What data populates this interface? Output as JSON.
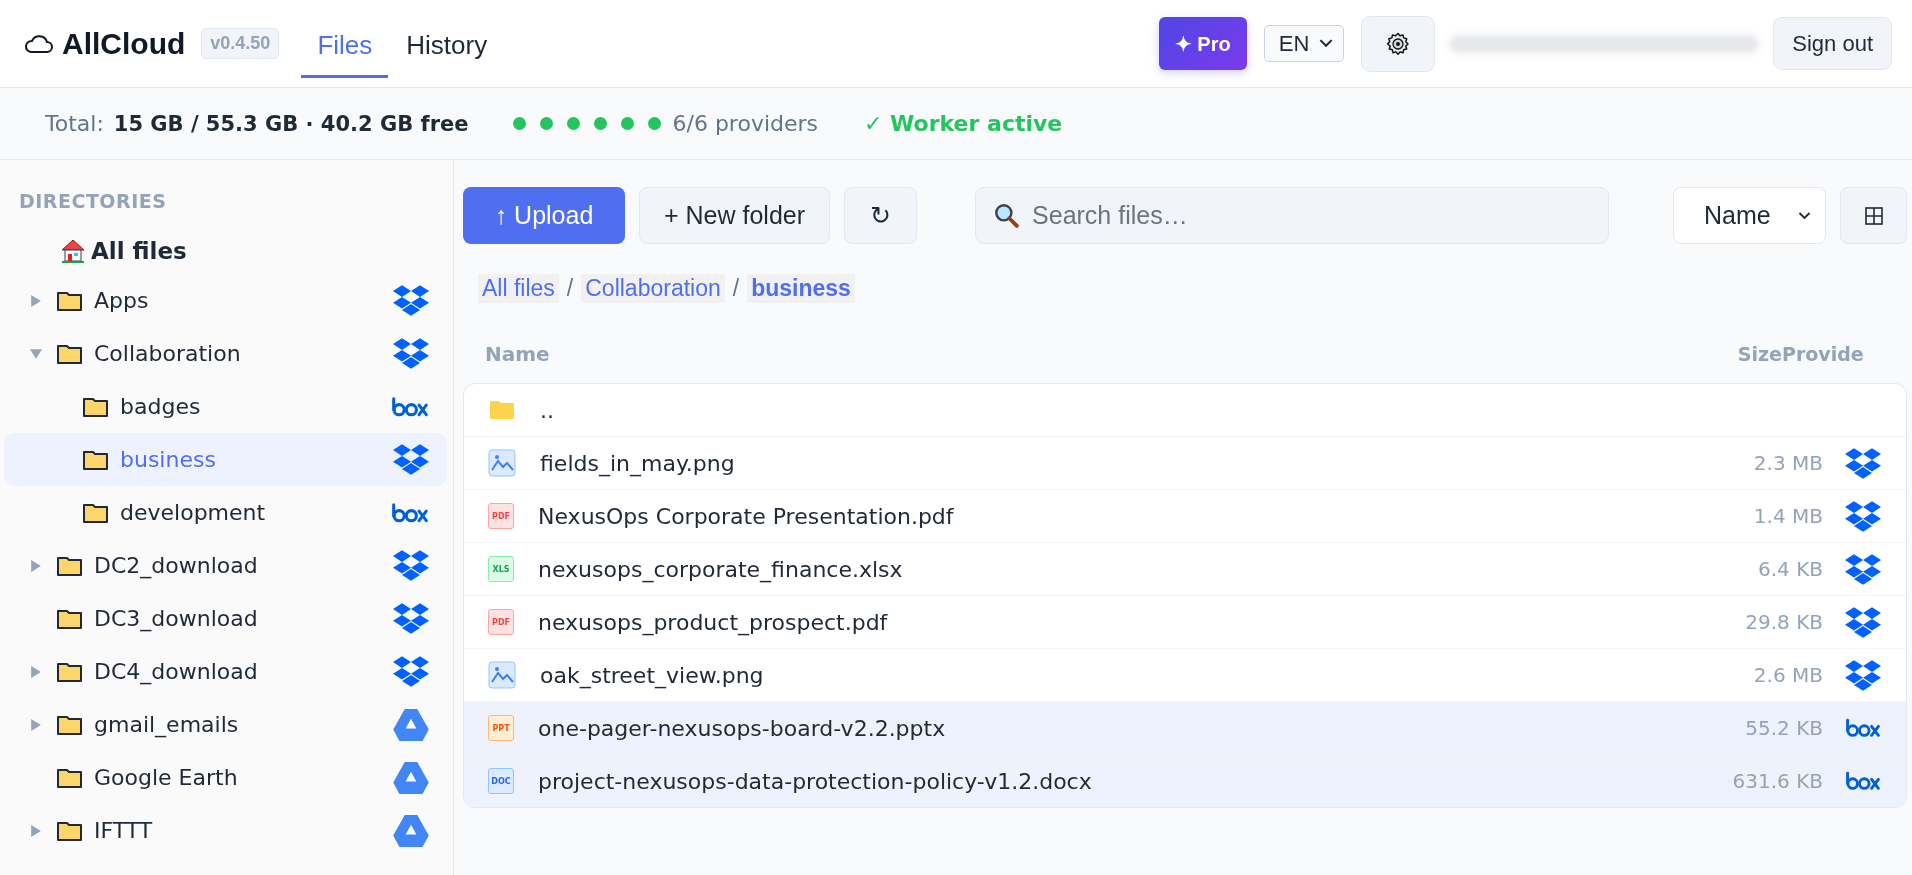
{
  "header": {
    "logo": "AllCloud",
    "version": "v0.4.50",
    "tabs": [
      {
        "label": "Files",
        "selected": true
      },
      {
        "label": "History",
        "selected": false
      }
    ],
    "pro_button": "✦ Pro",
    "language": "EN",
    "sign_out": "Sign out"
  },
  "stats": {
    "total_label": "Total:",
    "total_value": "15 GB / 55.3 GB · 40.2 GB free",
    "provider_dots": [
      {
        "color": "#22c55e"
      },
      {
        "color": "#22c55e"
      },
      {
        "color": "#22c55e"
      },
      {
        "color": "#22c55e"
      },
      {
        "color": "#22c55e"
      },
      {
        "color": "#22c55e"
      }
    ],
    "providers_text": "6/6 providers",
    "worker": "✓ Worker active"
  },
  "sidebar": {
    "title": "DIRECTORIES",
    "root": "All files",
    "items": [
      {
        "label": "Apps",
        "provider": {
          "kind": "dropbox"
        },
        "expandable": true,
        "expanded": false,
        "selected": false
      },
      {
        "label": "Collaboration",
        "provider": {
          "kind": "dropbox"
        },
        "expandable": true,
        "expanded": true,
        "selected": false,
        "children": [
          {
            "label": "badges",
            "provider": {
              "kind": "box"
            },
            "expandable": false,
            "selected": false
          },
          {
            "label": "business",
            "provider": {
              "kind": "dropbox"
            },
            "expandable": false,
            "selected": true
          },
          {
            "label": "development",
            "provider": {
              "kind": "box"
            },
            "expandable": false,
            "selected": false
          }
        ]
      },
      {
        "label": "DC2_download",
        "provider": {
          "kind": "dropbox"
        },
        "expandable": true,
        "expanded": false,
        "selected": false
      },
      {
        "label": "DC3_download",
        "provider": {
          "kind": "dropbox"
        },
        "expandable": false,
        "selected": false
      },
      {
        "label": "DC4_download",
        "provider": {
          "kind": "dropbox"
        },
        "expandable": true,
        "expanded": false,
        "selected": false
      },
      {
        "label": "gmail_emails",
        "provider": {
          "kind": "gdrive"
        },
        "expandable": true,
        "expanded": false,
        "selected": false
      },
      {
        "label": "Google Earth",
        "provider": {
          "kind": "gdrive"
        },
        "expandable": false,
        "selected": false
      },
      {
        "label": "IFTTT",
        "provider": {
          "kind": "gdrive"
        },
        "expandable": true,
        "expanded": false,
        "selected": false
      }
    ]
  },
  "toolbar": {
    "upload": "↑ Upload",
    "new_folder": "+ New folder",
    "refresh": "↻",
    "search": {
      "placeholder": "Search files…"
    },
    "sort": "Name"
  },
  "breadcrumb": [
    {
      "kind": "link",
      "label": "All files"
    },
    {
      "kind": "sep",
      "label": "/"
    },
    {
      "kind": "link",
      "label": "Collaboration"
    },
    {
      "kind": "sep",
      "label": "/"
    },
    {
      "kind": "current",
      "label": "business"
    }
  ],
  "table": {
    "columns": [
      "Name",
      "Size",
      "Provide"
    ],
    "rows": [
      {
        "kind": "folder",
        "name": "..",
        "selected": false
      },
      {
        "kind": "image",
        "name": "fields_in_may.png",
        "size": "2.3 MB",
        "provider": {
          "kind": "dropbox"
        },
        "selected": false
      },
      {
        "kind": "pdf",
        "badge": "PDF",
        "name": "NexusOps Corporate Presentation.pdf",
        "size": "1.4 MB",
        "provider": {
          "kind": "dropbox"
        },
        "selected": false
      },
      {
        "kind": "xls",
        "badge": "XLS",
        "name": "nexusops_corporate_finance.xlsx",
        "size": "6.4 KB",
        "provider": {
          "kind": "dropbox"
        },
        "selected": false
      },
      {
        "kind": "pdf",
        "badge": "PDF",
        "name": "nexusops_product_prospect.pdf",
        "size": "29.8 KB",
        "provider": {
          "kind": "dropbox"
        },
        "selected": false
      },
      {
        "kind": "image",
        "name": "oak_street_view.png",
        "size": "2.6 MB",
        "provider": {
          "kind": "dropbox"
        },
        "selected": false
      },
      {
        "kind": "ppt",
        "badge": "PPT",
        "name": "one-pager-nexusops-board-v2.2.pptx",
        "size": "55.2 KB",
        "provider": {
          "kind": "box"
        },
        "selected": true
      },
      {
        "kind": "doc",
        "badge": "DOC",
        "name": "project-nexusops-data-protection-policy-v1.2.docx",
        "size": "631.6 KB",
        "provider": {
          "kind": "box"
        },
        "selected": true
      }
    ]
  }
}
